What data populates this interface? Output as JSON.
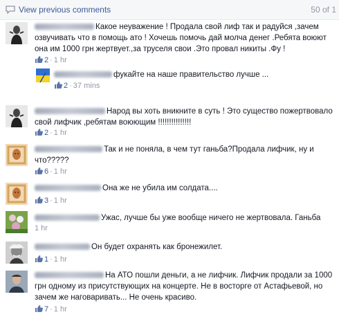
{
  "header": {
    "view_previous": "View previous comments",
    "count": "50 of 1"
  },
  "colors": {
    "link": "#3b5998",
    "meta": "#9197a3",
    "text": "#141823"
  },
  "comments": [
    {
      "text": "Какое неуважение ! Продала свой лиф так и радуйся ,зачем озвучивать что в помощь ато ! Хочешь помочь дай молча денег .Ребята воюют она им 1000 грн жертвует.,за труселя свои .Это провал никиты .Фу !",
      "likes": "2",
      "time": "1 hr",
      "avatar": "user-photo",
      "reply": {
        "text": "фукайте на наше правительство лучше ...",
        "likes": "2",
        "time": "37 mins",
        "avatar": "ukraine-flag"
      }
    },
    {
      "text": "Народ вы хоть вникните в суть ! Это существо пожертвовало свой лифчик ,ребятам воюющим !!!!!!!!!!!!!!!",
      "likes": "2",
      "time": "1 hr",
      "avatar": "user-photo"
    },
    {
      "text": "Так и не поняла, в чем тут ганьба?Продала лифчик, ну и что?????",
      "likes": "6",
      "time": "1 hr",
      "avatar": "icon-image"
    },
    {
      "text": "Она же не убила им солдата....",
      "likes": "3",
      "time": "1 hr",
      "avatar": "icon-image"
    },
    {
      "text": "Ужас, лучше бы уже вообще ничего не жертвовала. Ганьба",
      "time": "1 hr",
      "avatar": "flowers"
    },
    {
      "text": "Он будет охранять как бронежилет.",
      "likes": "1",
      "time": "1 hr",
      "avatar": "einstein"
    },
    {
      "text": "На АТО пошли деньги, а не лифчик. Лифчик продали за 1000 грн одному из присутствующих на концерте. Не в восторге от Астафьевой, но зачем же наговаривать... Не очень красиво.",
      "likes": "7",
      "time": "1 hr",
      "avatar": "user-photo-2"
    }
  ]
}
